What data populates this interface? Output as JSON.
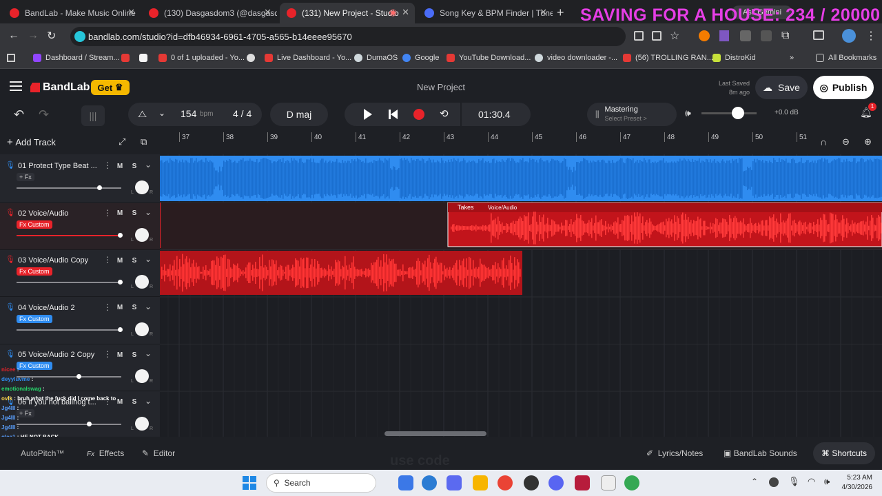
{
  "browser": {
    "tabs": [
      {
        "title": "BandLab - Make Music Online"
      },
      {
        "title": "(130) Dasgasdom3 (@dasgasdo"
      },
      {
        "title": "(131) New Project - Studio"
      },
      {
        "title": "Song Key & BPM Finder | Tunel"
      }
    ],
    "new_tab": "+",
    "overlay_banner": "SAVING FOR A HOUSE: 234 / 20000",
    "gemini": "Ask Gemini",
    "url": "bandlab.com/studio?id=dfb46934-6961-4705-a565-b14eeee95670",
    "bookmarks": [
      {
        "label": "Dashboard / Stream...",
        "color": "#9146ff"
      },
      {
        "label": "",
        "color": "#e53935"
      },
      {
        "label": "",
        "color": "#f5f5f5"
      },
      {
        "label": "0 of 1 uploaded - Yo...",
        "color": "#e53935"
      },
      {
        "label": "",
        "color": "#dddddd"
      },
      {
        "label": "Live Dashboard - Yo...",
        "color": "#e53935"
      },
      {
        "label": "DumaOS",
        "color": "#cfd8dc"
      },
      {
        "label": "Google",
        "color": "#4285f4"
      },
      {
        "label": "YouTube Download...",
        "color": "#e53935"
      },
      {
        "label": "video downloader -...",
        "color": "#cfd8dc"
      },
      {
        "label": "(56) TROLLING RAN...",
        "color": "#e53935"
      },
      {
        "label": "DistroKid",
        "color": "#c6e03a"
      }
    ],
    "all_bookmarks": "All Bookmarks"
  },
  "studio": {
    "logo": "BandLab",
    "get_label": "Get",
    "project_title": "New Project",
    "last_saved_label": "Last Saved",
    "last_saved_time": "8m ago",
    "save_label": "Save",
    "publish_label": "Publish",
    "bpm_value": "154",
    "bpm_unit": "bpm",
    "time_sig": "4 / 4",
    "key": "D maj",
    "time": "01:30.4",
    "mastering_title": "Mastering",
    "mastering_sub": "Select Preset >",
    "db_value": "+0.0 dB",
    "notification_count": "1",
    "add_track_label": "Add Track",
    "ruler": [
      "37",
      "38",
      "39",
      "40",
      "41",
      "42",
      "43",
      "44",
      "45",
      "46",
      "47",
      "48",
      "49",
      "50",
      "51"
    ],
    "region_takes_label": "Takes",
    "region_voice_label": "Voice/Audio"
  },
  "tracks": [
    {
      "name": "01  Protect Type Beat ...",
      "fx": "+ Fx",
      "fx_color": "transparent",
      "accent": "#2f8cf0",
      "volume": 0.8
    },
    {
      "name": "02  Voice/Audio",
      "fx": "Fx Custom",
      "fx_color": "#e8232a",
      "accent": "#e8232a",
      "volume": 1.0
    },
    {
      "name": "03  Voice/Audio Copy",
      "fx": "Fx Custom",
      "fx_color": "#e8232a",
      "accent": "#e8232a",
      "volume": 1.0
    },
    {
      "name": "04  Voice/Audio 2",
      "fx": "Fx Custom",
      "fx_color": "#2f8cf0",
      "accent": "#2f8cf0",
      "volume": 1.0
    },
    {
      "name": "05  Voice/Audio 2 Copy",
      "fx": "Fx Custom",
      "fx_color": "#2f8cf0",
      "accent": "#2f8cf0",
      "volume": 0.6
    },
    {
      "name": "06  if you not ballhog t...",
      "fx": "+ Fx",
      "fx_color": "transparent",
      "accent": "#2f8cf0",
      "volume": 0.7
    }
  ],
  "track_buttons": {
    "mute": "M",
    "solo": "S"
  },
  "bottom": {
    "autopitch": "AutoPitch™",
    "effects": "Effects",
    "editor": "Editor",
    "lyrics": "Lyrics/Notes",
    "sounds": "BandLab Sounds",
    "shortcuts": "Shortcuts",
    "watermark": "use code"
  },
  "chat": [
    {
      "user": "nicee",
      "text": ""
    },
    {
      "user": "deyyluvme",
      "text": ""
    },
    {
      "user": "emotionalswag",
      "text": ""
    },
    {
      "user": "ovlk",
      "text": "bruh what the fuck did I come back to"
    },
    {
      "user": "Jg4lll",
      "text": ""
    },
    {
      "user": "Jg4lll",
      "text": ""
    },
    {
      "user": "Jg4lll",
      "text": ""
    },
    {
      "user": "glee1",
      "text": "HE NOT BACK"
    },
    {
      "user": "Jg4lll",
      "text": ""
    }
  ],
  "taskbar": {
    "search_placeholder": "Search",
    "time": "5:23 AM",
    "date": "4/30/2026"
  }
}
